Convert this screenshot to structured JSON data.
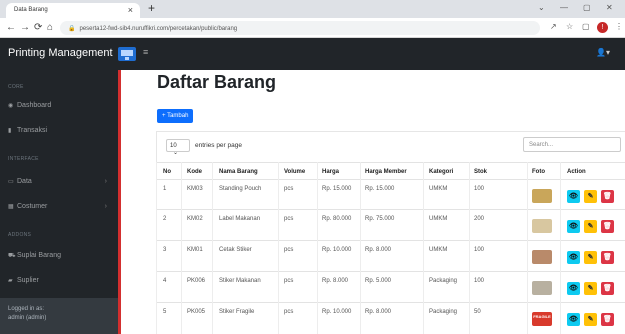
{
  "browser": {
    "tab_title": "Data Barang",
    "tab_close": "×",
    "new_tab": "+",
    "url": "peserta12-fwd-sib4.nuruffikri.com/percetakan/public/barang",
    "back": "←",
    "forward": "→",
    "reload": "⟳",
    "home": "⌂",
    "lock": "🔒",
    "minimize": "—",
    "maximize": "▢",
    "close": "✕",
    "share": "↗",
    "star": "☆",
    "sidepanel": "▢",
    "ext": "!",
    "menu": "⋮",
    "chevron": "⌄"
  },
  "app": {
    "brand": "Printing Management",
    "hamburger": "≡",
    "user_icon": "👤▾"
  },
  "sidebar": {
    "sections": [
      {
        "heading": "CORE",
        "items": [
          {
            "label": "Dashboard",
            "icon": "◉"
          }
        ]
      },
      {
        "heading": "",
        "items": [
          {
            "label": "Transaksi",
            "icon": "▮"
          }
        ]
      },
      {
        "heading": "INTERFACE",
        "items": [
          {
            "label": "Data",
            "icon": "▭",
            "chevron": "›"
          },
          {
            "label": "Costumer",
            "icon": "▦",
            "chevron": "›"
          }
        ]
      },
      {
        "heading": "ADDONS",
        "items": [
          {
            "label": "Suplai Barang",
            "icon": "⛟"
          },
          {
            "label": "Suplier",
            "icon": "▰"
          }
        ]
      }
    ],
    "footer_line1": "Logged in as:",
    "footer_line2": "admin (admin)"
  },
  "main": {
    "title": "Daftar Barang",
    "add_button": "+ Tambah",
    "length_value": "10",
    "length_chevron": "⌄",
    "length_label": "entries per page",
    "search_placeholder": "Search..."
  },
  "table": {
    "headers": [
      "No",
      "Kode",
      "Nama Barang",
      "Volume",
      "Harga",
      "Harga Member",
      "Kategori",
      "Stok",
      "Foto",
      "Action"
    ],
    "rows": [
      [
        "1",
        "KM03",
        "Standing Pouch",
        "pcs",
        "Rp. 15.000",
        "Rp. 15.000",
        "UMKM",
        "100"
      ],
      [
        "2",
        "KM02",
        "Label Makanan",
        "pcs",
        "Rp. 80.000",
        "Rp. 75.000",
        "UMKM",
        "200"
      ],
      [
        "3",
        "KM01",
        "Cetak Stiker",
        "pcs",
        "Rp. 10.000",
        "Rp. 8.000",
        "UMKM",
        "100"
      ],
      [
        "4",
        "PK006",
        "Stiker Makanan",
        "pcs",
        "Rp. 8.000",
        "Rp. 5.000",
        "Packaging",
        "100"
      ],
      [
        "5",
        "PK005",
        "Stiker Fragile",
        "pcs",
        "Rp. 10.000",
        "Rp. 8.000",
        "Packaging",
        "50"
      ]
    ],
    "photo_colors": [
      "#c9a65a",
      "#d8c7a0",
      "#b98a6a",
      "#b8b0a0",
      "#d83a2c"
    ],
    "photo_texts": [
      "",
      "",
      "",
      "",
      "FRAGILE"
    ],
    "action_icons": {
      "view": "👁",
      "edit": "✎",
      "delete": "🗑"
    }
  },
  "colors": {
    "primary": "#0d6efd",
    "info": "#0dcaf0",
    "warning": "#ffc107",
    "danger": "#dc3545",
    "sidebar_bg": "#212529"
  }
}
